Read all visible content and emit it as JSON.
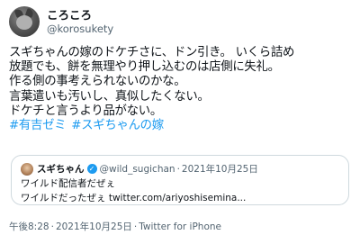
{
  "user": {
    "display_name": "ころころ",
    "handle": "@korosukety"
  },
  "tweet": {
    "lines": [
      "スギちゃんの嫁のドケチさに、ドン引き。 いくら詰め",
      "放題でも、餅を無理やり押し込むのは店側に失礼。",
      "作る側の事考えられないのかな。",
      "言葉遣いも汚いし、真似したくない。",
      "ドケチと言うより品がない。"
    ],
    "hashtags": [
      "#有吉ゼミ",
      "#スギちゃんの嫁"
    ]
  },
  "quoted_tweet": {
    "display_name": "スギちゃん",
    "handle": "@wild_sugichan",
    "separator": "·",
    "date": "2021年10月25日",
    "lines": [
      "ワイルド配信者だぜぇ",
      "ワイルドだったぜぇ twitter.com/ariyoshisemina..."
    ]
  },
  "footer": {
    "time": "午後8:28",
    "date": "2021年10月25日",
    "source": "Twitter for iPhone",
    "separator": "·"
  },
  "colors": {
    "link": "#1d9bf0",
    "secondary_text": "#536471",
    "border": "#cfd9de"
  },
  "icons": {
    "verified": "verified-badge-icon"
  }
}
